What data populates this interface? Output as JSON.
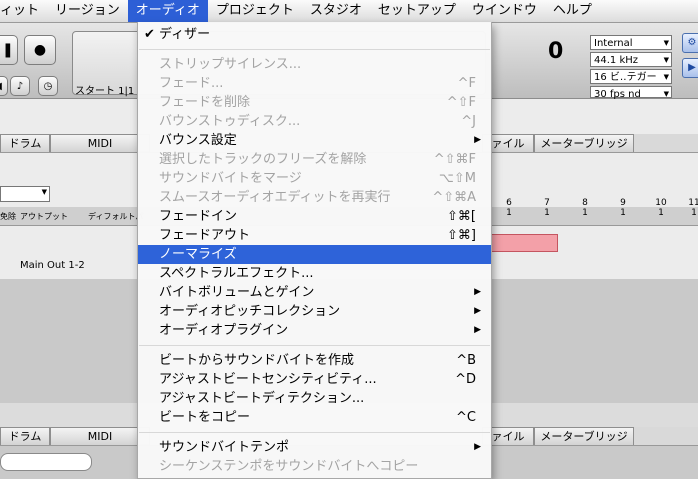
{
  "menubar": {
    "items": [
      {
        "label": "ィット",
        "active": false
      },
      {
        "label": "リージョン",
        "active": false
      },
      {
        "label": "オーディオ",
        "active": true
      },
      {
        "label": "プロジェクト",
        "active": false
      },
      {
        "label": "スタジオ",
        "active": false
      },
      {
        "label": "セットアップ",
        "active": false
      },
      {
        "label": "ウインドウ",
        "active": false
      },
      {
        "label": "ヘルプ",
        "active": false
      }
    ]
  },
  "background": {
    "lcd_start": "スタート 1|1",
    "lcd_bignum": "0",
    "sync_source": "Internal",
    "sample_rate": "44.1 kHz",
    "bit_depth": "16 ビ‥テガー",
    "frame_rate": "30 fps nd",
    "tabs_top": [
      "ドラム",
      "MIDI",
      "ァイル",
      "メーターブリッジ"
    ],
    "tabs_bottom": [
      "ドラム",
      "MIDI",
      "ァイル",
      "メーターブリッジ"
    ],
    "column_headers": [
      "免除",
      "アウトプット",
      "ディフォルトパ"
    ],
    "main_out": "Main Out 1-2",
    "ruler_numbers": [
      "6",
      "7",
      "8",
      "9",
      "10",
      "11"
    ],
    "ruler_sub": "1"
  },
  "menu": {
    "items": [
      {
        "label": "ディザー",
        "shortcut": "",
        "checked": true,
        "disabled": false,
        "submenu": false
      },
      {
        "separator": true
      },
      {
        "label": "ストリップサイレンス...",
        "shortcut": "",
        "disabled": true,
        "submenu": false
      },
      {
        "label": "フェード...",
        "shortcut": "^F",
        "disabled": true,
        "submenu": false
      },
      {
        "label": "フェードを削除",
        "shortcut": "^⇧F",
        "disabled": true,
        "submenu": false
      },
      {
        "label": "バウンストゥディスク...",
        "shortcut": "^J",
        "disabled": true,
        "submenu": false
      },
      {
        "label": "バウンス設定",
        "shortcut": "",
        "disabled": false,
        "submenu": true
      },
      {
        "label": "選択したトラックのフリーズを解除",
        "shortcut": "^⇧⌘F",
        "disabled": true,
        "submenu": false
      },
      {
        "label": "サウンドバイトをマージ",
        "shortcut": "⌥⇧M",
        "disabled": true,
        "submenu": false
      },
      {
        "label": "スムースオーディオエディットを再実行",
        "shortcut": "^⇧⌘A",
        "disabled": true,
        "submenu": false
      },
      {
        "label": "フェードイン",
        "shortcut": "⇧⌘[",
        "disabled": false,
        "submenu": false
      },
      {
        "label": "フェードアウト",
        "shortcut": "⇧⌘]",
        "disabled": false,
        "submenu": false
      },
      {
        "label": "ノーマライズ",
        "shortcut": "",
        "disabled": false,
        "submenu": false,
        "highlighted": true
      },
      {
        "label": "スペクトラルエフェクト...",
        "shortcut": "",
        "disabled": false,
        "submenu": false
      },
      {
        "label": "バイトボリュームとゲイン",
        "shortcut": "",
        "disabled": false,
        "submenu": true
      },
      {
        "label": "オーディオピッチコレクション",
        "shortcut": "",
        "disabled": false,
        "submenu": true
      },
      {
        "label": "オーディオプラグイン",
        "shortcut": "",
        "disabled": false,
        "submenu": true
      },
      {
        "separator": true
      },
      {
        "label": "ビートからサウンドバイトを作成",
        "shortcut": "^B",
        "disabled": false,
        "submenu": false
      },
      {
        "label": "アジャストビートセンシティビティ...",
        "shortcut": "^D",
        "disabled": false,
        "submenu": false
      },
      {
        "label": "アジャストビートディテクション...",
        "shortcut": "",
        "disabled": false,
        "submenu": false
      },
      {
        "label": "ビートをコピー",
        "shortcut": "^C",
        "disabled": false,
        "submenu": false
      },
      {
        "separator": true
      },
      {
        "label": "サウンドバイトテンポ",
        "shortcut": "",
        "disabled": false,
        "submenu": true
      },
      {
        "label": "シーケンステンポをサウンドバイトへコピー",
        "shortcut": "",
        "disabled": true,
        "submenu": false
      }
    ]
  }
}
